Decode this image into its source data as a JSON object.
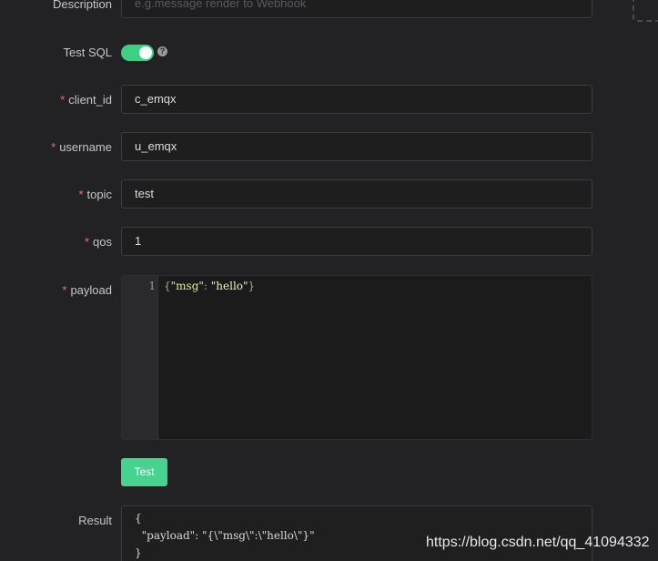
{
  "form": {
    "description": {
      "label": "Description",
      "placeholder": "e.g.message render to Webhook"
    },
    "test_sql": {
      "label": "Test SQL",
      "enabled": true,
      "help": "?"
    },
    "client_id": {
      "label": "client_id",
      "required": "*",
      "value": "c_emqx"
    },
    "username": {
      "label": "username",
      "required": "*",
      "value": "u_emqx"
    },
    "topic": {
      "label": "topic",
      "required": "*",
      "value": "test"
    },
    "qos": {
      "label": "qos",
      "required": "*",
      "value": "1"
    },
    "payload": {
      "label": "payload",
      "required": "*",
      "line_number": "1",
      "tokens": {
        "open": "{",
        "key": "\"msg\"",
        "colon": ": ",
        "value": "\"hello\"",
        "close": "}"
      }
    },
    "test_button": "Test",
    "result": {
      "label": "Result",
      "text": "{\n  \"payload\": \"{\\\"msg\\\":\\\"hello\\\"}\"\n}"
    }
  },
  "watermark": "https://blog.csdn.net/qq_41094332"
}
